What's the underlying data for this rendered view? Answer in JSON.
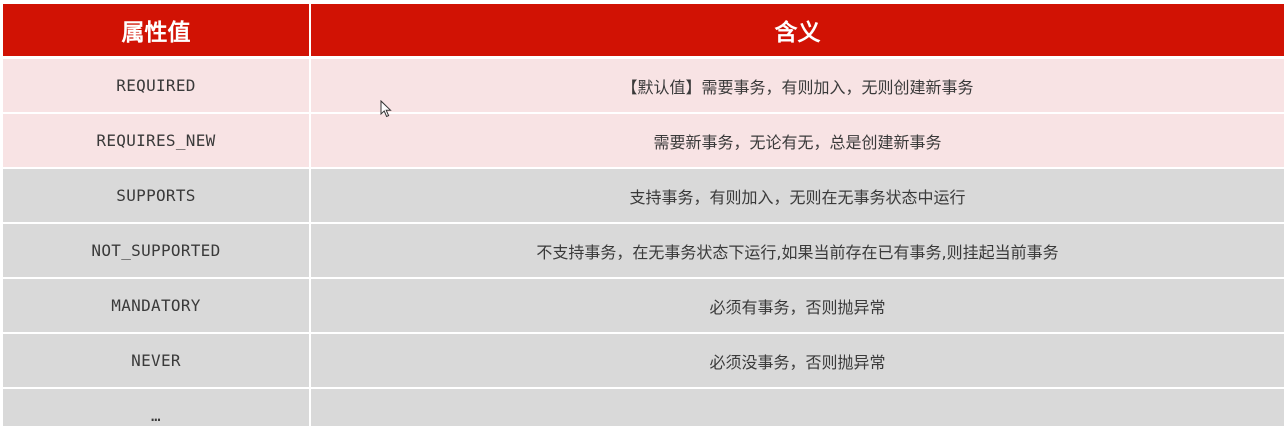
{
  "table": {
    "headers": [
      "属性值",
      "含义"
    ],
    "rows": [
      {
        "value": "REQUIRED",
        "meaning": "【默认值】需要事务，有则加入，无则创建新事务"
      },
      {
        "value": "REQUIRES_NEW",
        "meaning": "需要新事务，无论有无，总是创建新事务"
      },
      {
        "value": "SUPPORTS",
        "meaning": "支持事务，有则加入，无则在无事务状态中运行"
      },
      {
        "value": "NOT_SUPPORTED",
        "meaning": "不支持事务，在无事务状态下运行,如果当前存在已有事务,则挂起当前事务"
      },
      {
        "value": "MANDATORY",
        "meaning": "必须有事务，否则抛异常"
      },
      {
        "value": "NEVER",
        "meaning": "必须没事务，否则抛异常"
      },
      {
        "value": "…",
        "meaning": ""
      }
    ]
  },
  "colors": {
    "header_bg": "#d11204",
    "header_text": "#ffffff",
    "highlight_row_bg": "#f8e3e4",
    "normal_row_bg": "#d9d9d9",
    "cell_text": "#3a3a3a"
  },
  "icons": {
    "cursor": "mouse-pointer-icon"
  }
}
